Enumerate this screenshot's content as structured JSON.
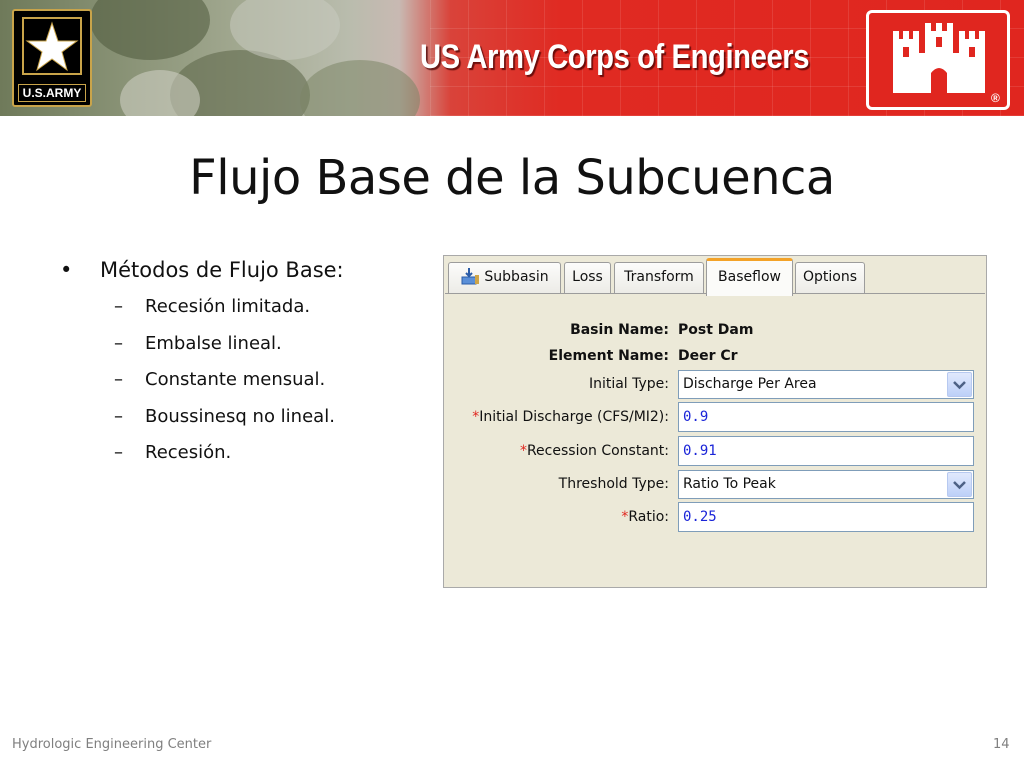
{
  "banner": {
    "army_logo_text": "U.S.ARMY",
    "org_title": "US Army Corps of Engineers",
    "registered_mark": "®"
  },
  "slide": {
    "title": "Flujo Base de la Subcuenca",
    "bullet_main": "Métodos de Flujo Base:",
    "bullet_symbol": "•",
    "sub_symbol": "–",
    "sub_items": [
      "Recesión limitada.",
      "Embalse lineal.",
      "Constante mensual.",
      "Boussinesq no lineal.",
      "Recesión."
    ]
  },
  "editor": {
    "tabs": [
      "Subbasin",
      "Loss",
      "Transform",
      "Baseflow",
      "Options"
    ],
    "active_tab": "Baseflow",
    "required_marker": "*",
    "basin_name_label": "Basin Name:",
    "basin_name_value": "Post Dam",
    "element_name_label": "Element Name:",
    "element_name_value": "Deer Cr",
    "initial_type_label": "Initial Type:",
    "initial_type_value": "Discharge Per Area",
    "initial_discharge_label": "Initial Discharge (CFS/MI2):",
    "initial_discharge_value": "0.9",
    "recession_constant_label": "Recession Constant:",
    "recession_constant_value": "0.91",
    "threshold_type_label": "Threshold Type:",
    "threshold_type_value": "Ratio To Peak",
    "ratio_label": "Ratio:",
    "ratio_value": "0.25"
  },
  "footer": {
    "organization": "Hydrologic Engineering Center",
    "page_number": "14"
  },
  "colors": {
    "banner_red": "#e0261f",
    "tab_active_accent": "#f3a228",
    "field_value_blue": "#1a24d8",
    "required_red": "#e0261f"
  },
  "icons": {
    "army_star": "star-icon",
    "castle": "castle-icon",
    "subbasin_tab": "subbasin-icon",
    "dropdown": "chevron-down-icon"
  }
}
